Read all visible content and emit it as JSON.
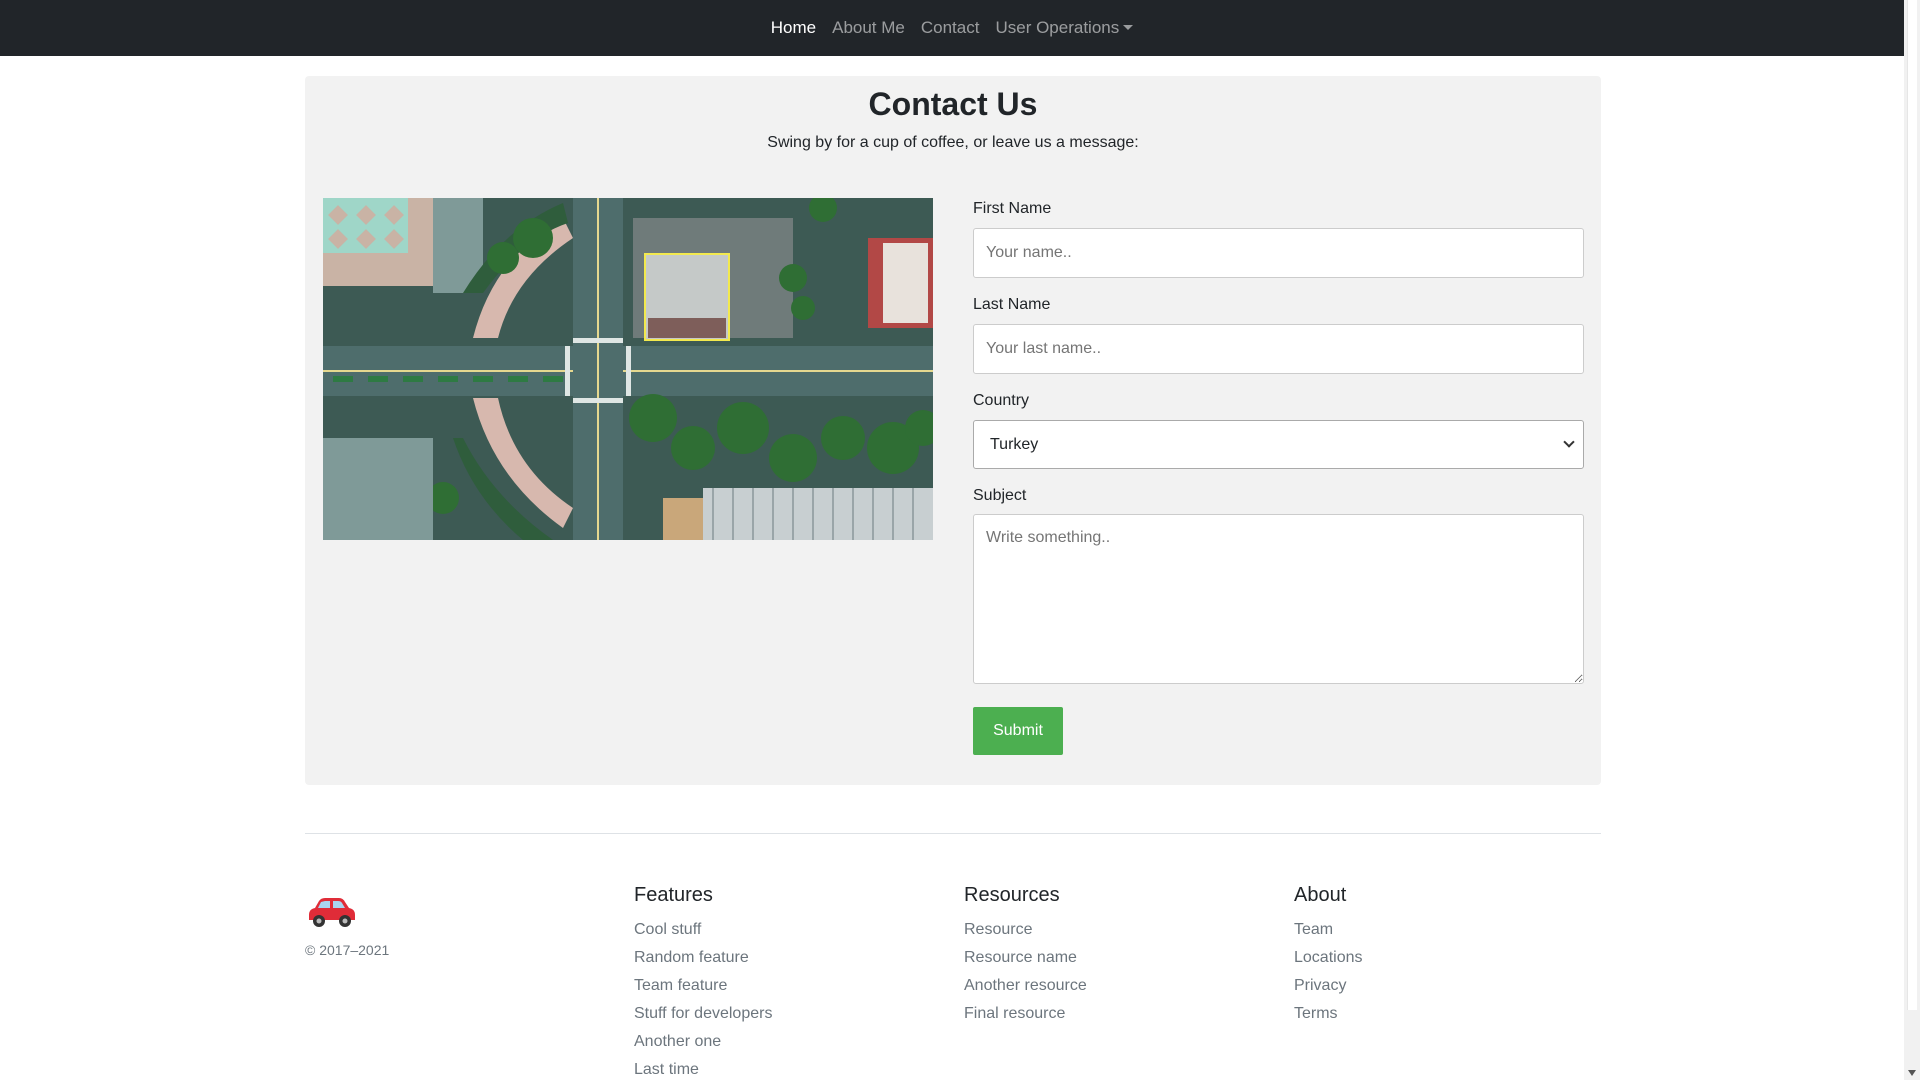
{
  "nav": {
    "items": [
      {
        "label": "Home",
        "active": true
      },
      {
        "label": "About Me",
        "active": false
      },
      {
        "label": "Contact",
        "active": false
      },
      {
        "label": "User Operations",
        "active": false,
        "dropdown": true
      }
    ]
  },
  "contact": {
    "title": "Contact Us",
    "subtitle": "Swing by for a cup of coffee, or leave us a message:",
    "image_icon": "aerial-city-photo",
    "first_name_label": "First Name",
    "first_name_placeholder": "Your name..",
    "last_name_label": "Last Name",
    "last_name_placeholder": "Your last name..",
    "country_label": "Country",
    "country_value": "Turkey",
    "subject_label": "Subject",
    "subject_placeholder": "Write something..",
    "submit_label": "Submit",
    "submit_color": "#4caf50"
  },
  "footer": {
    "logo_icon": "car-icon",
    "copyright": "© 2017–2021",
    "columns": [
      {
        "title": "Features",
        "links": [
          "Cool stuff",
          "Random feature",
          "Team feature",
          "Stuff for developers",
          "Another one",
          "Last time"
        ]
      },
      {
        "title": "Resources",
        "links": [
          "Resource",
          "Resource name",
          "Another resource",
          "Final resource"
        ]
      },
      {
        "title": "About",
        "links": [
          "Team",
          "Locations",
          "Privacy",
          "Terms"
        ]
      }
    ]
  },
  "colors": {
    "navbar_bg": "#212529",
    "card_bg": "#f2f2f2",
    "accent_green": "#4caf50"
  }
}
